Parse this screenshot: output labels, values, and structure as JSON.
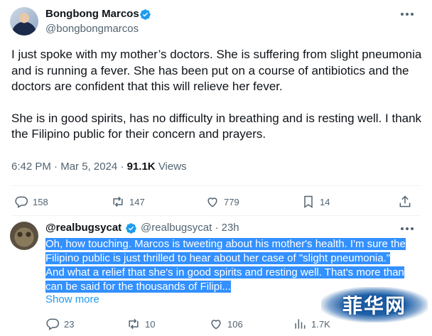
{
  "post": {
    "author_name": "Bongbong Marcos",
    "handle": "@bongbongmarcos",
    "paragraphs": [
      "I just spoke with my mother’s doctors. She is suffering from slight pneumonia and is running a fever. She has been put on a course of antibiotics and the doctors are confident that this will relieve her fever.",
      "She is in good spirits, has no difficulty in breathing and is resting well. I thank the Filipino public for their concern and prayers."
    ],
    "time": "6:42 PM",
    "date": "Mar 5, 2024",
    "views_count": "91.1K",
    "views_label": "Views",
    "actions": {
      "replies": "158",
      "reposts": "147",
      "likes": "779",
      "bookmarks": "14"
    }
  },
  "reply": {
    "author_name": "@realbugsycat",
    "handle": "@realbugsycat",
    "age": "23h",
    "text": "Oh, how touching. Marcos is tweeting about his mother's health. I'm sure the Filipino public is just thrilled to hear about her case of \"slight pneumonia.\" And what a relief that she's in good spirits and resting well. That's more than can be said for the thousands of Filipi...",
    "show_more": "Show more",
    "actions": {
      "replies": "23",
      "reposts": "10",
      "likes": "106",
      "views": "1.7K"
    }
  },
  "watermark": {
    "text": "菲华网"
  },
  "colors": {
    "text_primary": "#0f1419",
    "text_secondary": "#536471",
    "link": "#1d9bf0",
    "verified": "#1d9bf0",
    "selection": "#3390ff"
  },
  "icons": [
    "verified-badge-icon",
    "more-icon",
    "reply-icon",
    "repost-icon",
    "like-icon",
    "views-icon",
    "bookmark-icon",
    "share-icon"
  ]
}
